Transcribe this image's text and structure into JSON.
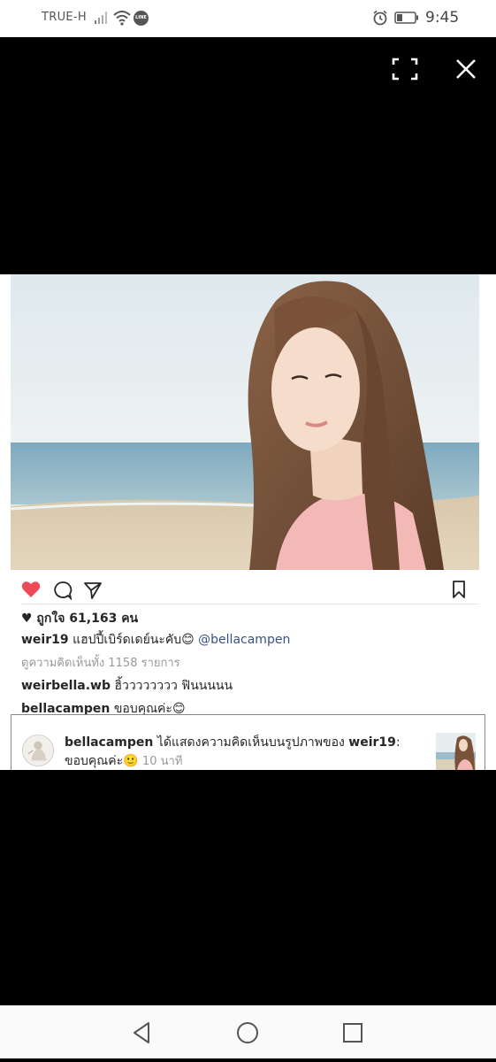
{
  "status_bar": {
    "carrier": "TRUE-H",
    "line_badge": "LINE",
    "time": "9:45",
    "icons": [
      "signal-icon",
      "wifi-icon",
      "line-app-icon",
      "alarm-icon",
      "battery-icon"
    ]
  },
  "viewer": {
    "icons": [
      "fullscreen-icon",
      "close-icon"
    ]
  },
  "post": {
    "likes": "♥ ถูกใจ 61,163 คน",
    "caption": {
      "user": "weir19",
      "text": " แฮปปี้เบิร์ดเดย์นะคับ😊 ",
      "mention": "@bellacampen"
    },
    "view_comments": "ดูความคิดเห็นทั้ง 1158 รายการ",
    "comments": [
      {
        "user": "weirbella.wb",
        "text": " ฮิ้วววววววว ฟินนนนน"
      },
      {
        "user": "bellacampen",
        "text": " ขอบคุณค่ะ😊"
      }
    ],
    "colors": {
      "like": "#ed4956",
      "text": "#262626",
      "muted": "#999999",
      "mention": "#385185"
    }
  },
  "notification": {
    "user": "bellacampen",
    "action": " ได้แสดงความคิดเห็นบนรูปภาพของ ",
    "target": "weir19",
    "suffix": ":",
    "comment": "ขอบคุณค่ะ🙂 ",
    "time": "10 นาที"
  },
  "nav_bar": {
    "icons": [
      "back-icon",
      "home-icon",
      "recents-icon"
    ]
  }
}
